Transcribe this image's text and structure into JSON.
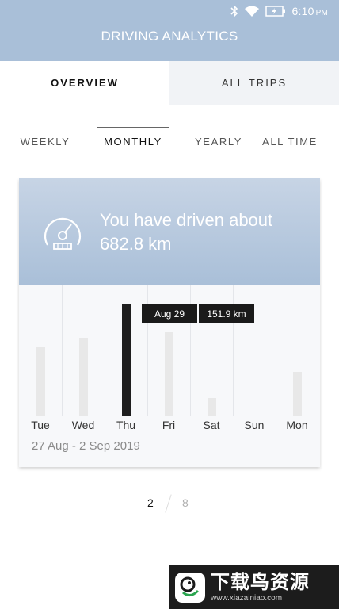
{
  "status_bar": {
    "time": "6:10",
    "ampm": "PM",
    "icons": [
      "bluetooth-icon",
      "wifi-icon",
      "battery-charging-icon"
    ]
  },
  "app": {
    "title": "DRIVING ANALYTICS"
  },
  "tabs": [
    {
      "label": "OVERVIEW",
      "active": true
    },
    {
      "label": "ALL TRIPS",
      "active": false
    }
  ],
  "periods": [
    {
      "label": "WEEKLY",
      "selected": false
    },
    {
      "label": "MONTHLY",
      "selected": true
    },
    {
      "label": "YEARLY",
      "selected": false
    },
    {
      "label": "ALL TIME",
      "selected": false
    }
  ],
  "summary": {
    "line1": "You have driven about",
    "line2": "682.8 km",
    "icon": "speedometer-icon"
  },
  "chart_data": {
    "type": "bar",
    "categories": [
      "Tue",
      "Wed",
      "Thu",
      "Fri",
      "Sat",
      "Sun",
      "Mon"
    ],
    "values": [
      95,
      107,
      151.9,
      114,
      25,
      0,
      60
    ],
    "unit": "km",
    "ylim": [
      0,
      151.9
    ],
    "selected_index": 2,
    "tooltip": {
      "date": "Aug 29",
      "value": "151.9 km"
    },
    "date_range": "27 Aug - 2 Sep 2019",
    "colors": {
      "bar": "#e8e8e8",
      "selected_bar": "#1e1e1e"
    }
  },
  "pager": {
    "current": "2",
    "total": "8"
  },
  "watermark": {
    "text": "下载鸟资源",
    "url": "www.xiazainiao.com"
  },
  "colors": {
    "accent": "#a9bfd8",
    "header_gradient_top": "#c7d4e5"
  }
}
